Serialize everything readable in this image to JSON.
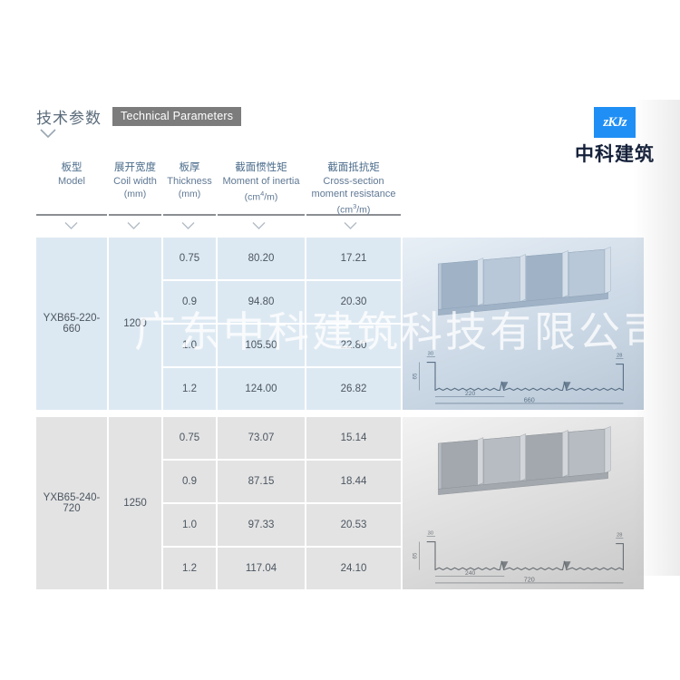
{
  "section": {
    "title_cn": "技术参数",
    "title_en": "Technical Parameters",
    "caret_icon": "chevron-down-icon"
  },
  "logo": {
    "mark_text": "zKJz",
    "name_cn": "中科建筑",
    "mark_color": "#1f8ff5",
    "name_color": "#15213a"
  },
  "watermark": {
    "text": "广东中科建筑科技有限公司"
  },
  "table": {
    "columns": [
      {
        "cn": "板型",
        "en": "Model",
        "unit": "",
        "unit_sup": ""
      },
      {
        "cn": "展开宽度",
        "en": "Coil width",
        "unit": "(mm)",
        "unit_sup": ""
      },
      {
        "cn": "板厚",
        "en": "Thickness",
        "unit": "(mm)",
        "unit_sup": ""
      },
      {
        "cn": "截面惯性矩",
        "en": "Moment of inertia",
        "unit_pre": "(cm",
        "unit_sup": "4",
        "unit_post": "/m)"
      },
      {
        "cn": "截面抵抗矩",
        "en": "Cross-section moment resistance",
        "unit_pre": "(cm",
        "unit_sup": "3",
        "unit_post": "/m)"
      }
    ],
    "blocks": [
      {
        "theme": "blue",
        "model": "YXB65-220-660",
        "coil_width": "1200",
        "rows": [
          {
            "thickness": "0.75",
            "inertia": "80.20",
            "resistance": "17.21"
          },
          {
            "thickness": "0.9",
            "inertia": "94.80",
            "resistance": "20.30"
          },
          {
            "thickness": "1.0",
            "inertia": "105.50",
            "resistance": "22.80"
          },
          {
            "thickness": "1.2",
            "inertia": "124.00",
            "resistance": "26.82"
          }
        ],
        "diagram": {
          "name": "profile-diagram-660",
          "dim_top_left": "30",
          "dim_height": "65",
          "dim_pitch": "220",
          "dim_total": "660",
          "dim_top_right": "28",
          "ribs": 3
        }
      },
      {
        "theme": "gray",
        "model": "YXB65-240-720",
        "coil_width": "1250",
        "rows": [
          {
            "thickness": "0.75",
            "inertia": "73.07",
            "resistance": "15.14"
          },
          {
            "thickness": "0.9",
            "inertia": "87.15",
            "resistance": "18.44"
          },
          {
            "thickness": "1.0",
            "inertia": "97.33",
            "resistance": "20.53"
          },
          {
            "thickness": "1.2",
            "inertia": "117.04",
            "resistance": "24.10"
          }
        ],
        "diagram": {
          "name": "profile-diagram-720",
          "dim_top_left": "30",
          "dim_height": "65",
          "dim_pitch": "240",
          "dim_total": "720",
          "dim_top_right": "28",
          "ribs": 3
        }
      }
    ]
  },
  "colors": {
    "cell_blue": "#dde9f2",
    "cell_gray": "#e3e3e3",
    "header_text": "#4a6b8a",
    "badge_bg": "#7c7c7c"
  }
}
